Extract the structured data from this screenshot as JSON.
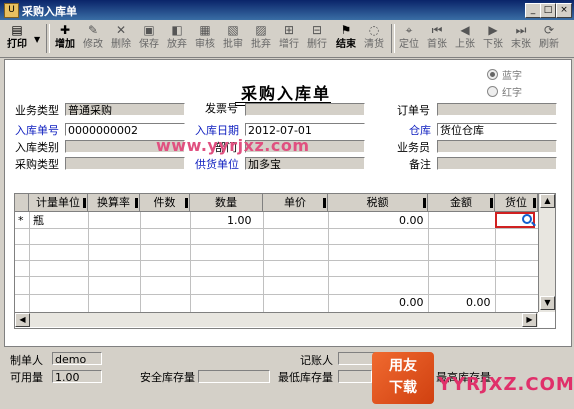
{
  "window": {
    "title": "采购入库单",
    "icon": "app-icon"
  },
  "toolbar": {
    "buttons": [
      {
        "id": "print",
        "label": "打印",
        "icon": "printer-icon"
      },
      {
        "id": "add",
        "label": "增加",
        "icon": "add-icon"
      },
      {
        "id": "edit",
        "label": "修改",
        "icon": "edit-icon"
      },
      {
        "id": "delete",
        "label": "删除",
        "icon": "delete-icon"
      },
      {
        "id": "save",
        "label": "保存",
        "icon": "save-icon"
      },
      {
        "id": "abandon",
        "label": "放弃",
        "icon": "abandon-icon"
      },
      {
        "id": "audit",
        "label": "审核",
        "icon": "audit-icon"
      },
      {
        "id": "approve",
        "label": "批审",
        "icon": "approve-icon"
      },
      {
        "id": "reject",
        "label": "批弃",
        "icon": "reject-icon"
      },
      {
        "id": "addrow",
        "label": "增行",
        "icon": "add-row-icon"
      },
      {
        "id": "delrow",
        "label": "删行",
        "icon": "delete-row-icon"
      },
      {
        "id": "finish",
        "label": "结束",
        "icon": "finish-icon"
      },
      {
        "id": "clear",
        "label": "清货",
        "icon": "clear-icon"
      },
      {
        "id": "locate",
        "label": "定位",
        "icon": "locate-icon"
      },
      {
        "id": "first",
        "label": "首张",
        "icon": "first-icon"
      },
      {
        "id": "prev",
        "label": "上张",
        "icon": "prev-icon"
      },
      {
        "id": "next",
        "label": "下张",
        "icon": "next-icon"
      },
      {
        "id": "last",
        "label": "末张",
        "icon": "last-icon"
      },
      {
        "id": "refresh",
        "label": "刷新",
        "icon": "refresh-icon"
      }
    ]
  },
  "doc": {
    "title": "采购入库单",
    "color_blue": "蓝字",
    "color_red": "红字",
    "business_type_label": "业务类型",
    "business_type": "普通采购",
    "invoice_no_label": "发票号",
    "invoice_no": "",
    "order_no_label": "订单号",
    "order_no": "",
    "receipt_no_label": "入库单号",
    "receipt_no": "0000000002",
    "receipt_date_label": "入库日期",
    "receipt_date": "2012-07-01",
    "warehouse_label": "仓库",
    "warehouse": "货位仓库",
    "receipt_type_label": "入库类别",
    "receipt_type": "",
    "dept_label": "部门",
    "dept": "",
    "clerk_label": "业务员",
    "clerk": "",
    "purchase_type_label": "采购类型",
    "purchase_type": "",
    "supplier_label": "供货单位",
    "supplier": "加多宝",
    "remark_label": "备注",
    "remark": "",
    "watermark": "www.yyrjxz.com"
  },
  "grid": {
    "columns": [
      "计量单位",
      "换算率",
      "件数",
      "数量",
      "单价",
      "税额",
      "金额",
      "货位"
    ],
    "rows": [
      {
        "marker": "*",
        "unit": "瓶",
        "rate": "",
        "pieces": "",
        "qty": "1.00",
        "price": "",
        "tax": "0.00",
        "amount": "",
        "location": ""
      }
    ],
    "totals": {
      "tax": "0.00",
      "amount": "0.00"
    }
  },
  "footer": {
    "maker_label": "制单人",
    "maker": "demo",
    "bookkeeper_label": "记账人",
    "bookkeeper": "",
    "available_label": "可用量",
    "available": "1.00",
    "safety_label": "安全库存量",
    "safety": "",
    "min_label": "最低库存量",
    "min": "",
    "max_label": "最高库存量",
    "max": "",
    "logo_line1": "用友",
    "logo_line2": "下载",
    "brand": "YYRJXZ.COM"
  }
}
